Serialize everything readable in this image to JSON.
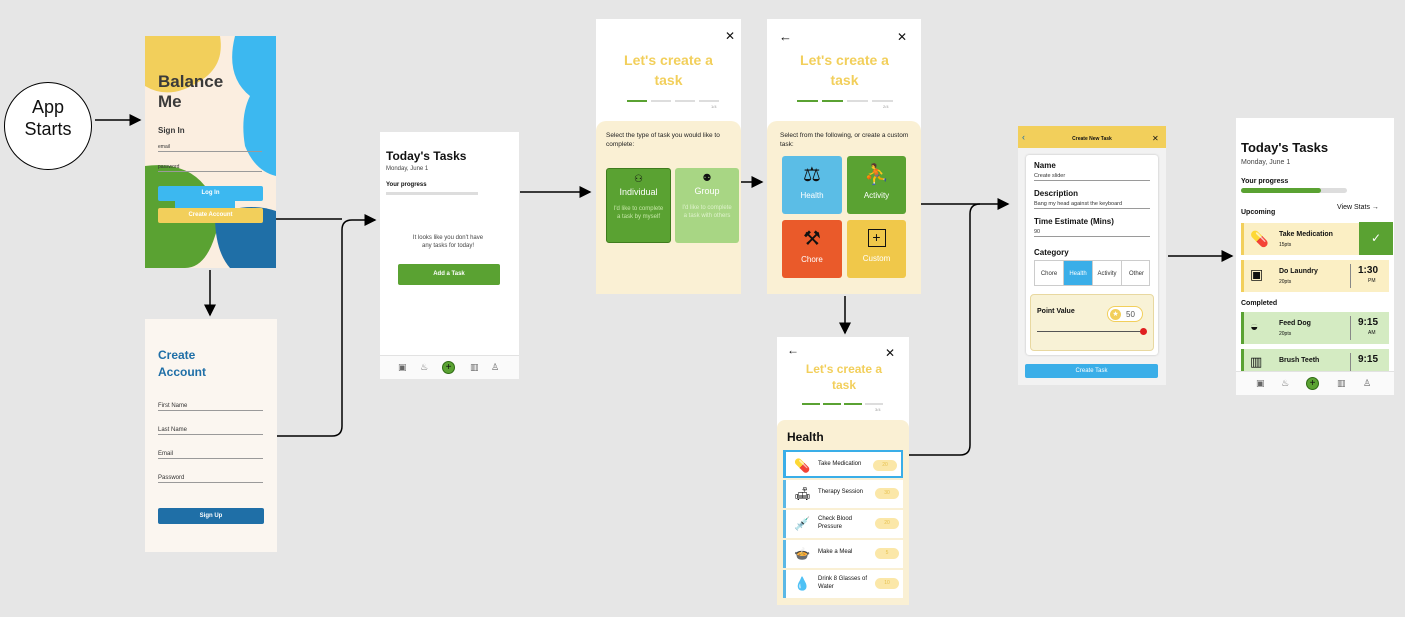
{
  "start": {
    "label": "App Starts"
  },
  "login": {
    "title": "Balance Me",
    "sign_in": "Sign In",
    "email_label": "email",
    "password_label": "password",
    "login_button": "Log In",
    "create_account_button": "Create Account"
  },
  "create_account": {
    "title": "Create Account",
    "fields": [
      "First Name",
      "Last Name",
      "Email",
      "Password"
    ],
    "signup_button": "Sign Up"
  },
  "tasks_empty": {
    "title": "Today's Tasks",
    "date": "Monday, June 1",
    "progress_label": "Your progress",
    "empty_message": "It looks like you don't have any tasks for today!",
    "add_button": "Add a Task"
  },
  "create_type": {
    "title": "Let's create a task",
    "close": "✕",
    "step": "1/4",
    "prompt": "Select the type of task you would like to complete:",
    "options": [
      {
        "label": "Individual",
        "desc": "I'd like to complete a task by myself",
        "icon": "individual-icon",
        "color": "#5aa232"
      },
      {
        "label": "Group",
        "desc": "I'd like to complete a task with others",
        "icon": "group-icon",
        "color": "#a8d684"
      }
    ]
  },
  "create_category": {
    "title": "Let's create a task",
    "back": "←",
    "close": "✕",
    "step": "2/4",
    "prompt": "Select from the following, or create a custom task:",
    "options": [
      {
        "label": "Health",
        "icon": "scale-icon",
        "color": "#5bbde6"
      },
      {
        "label": "Activity",
        "icon": "runner-icon",
        "color": "#5aa232"
      },
      {
        "label": "Chore",
        "icon": "broom-icon",
        "color": "#ea5a2a"
      },
      {
        "label": "Custom",
        "icon": "plus-box-icon",
        "color": "#f0c84a"
      }
    ]
  },
  "create_health": {
    "title": "Let's create a task",
    "back": "←",
    "close": "✕",
    "step": "3/4",
    "heading": "Health",
    "items": [
      {
        "label": "Take Medication",
        "points": "20",
        "icon": "pill-icon"
      },
      {
        "label": "Therapy Session",
        "points": "30",
        "icon": "couch-icon"
      },
      {
        "label": "Check Blood Pressure",
        "points": "20",
        "icon": "syringe-icon"
      },
      {
        "label": "Make a Meal",
        "points": "5",
        "icon": "meal-icon"
      },
      {
        "label": "Drink 8 Glasses of Water",
        "points": "10",
        "icon": "water-drop-icon"
      }
    ]
  },
  "new_task": {
    "header": "Create New Task",
    "name_label": "Name",
    "name_value": "Create slider",
    "desc_label": "Description",
    "desc_value": "Bang my head against the keyboard",
    "time_label": "Time Estimate (Mins)",
    "time_value": "90",
    "category_label": "Category",
    "categories": [
      "Chore",
      "Health",
      "Activity",
      "Other"
    ],
    "selected_category": "Health",
    "point_label": "Point Value",
    "point_value": "50",
    "submit": "Create Task"
  },
  "tasks_full": {
    "title": "Today's Tasks",
    "date": "Monday, June 1",
    "progress_label": "Your progress",
    "progress": 0.75,
    "upcoming_label": "Upcoming",
    "view_stats": "View Stats →",
    "upcoming": [
      {
        "name": "Take Medication",
        "pts": "15pts",
        "icon": "pill-icon",
        "action": "✓"
      },
      {
        "name": "Do Laundry",
        "pts": "20pts",
        "icon": "washer-icon",
        "time": "1:30",
        "ampm": "PM"
      }
    ],
    "completed_label": "Completed",
    "completed": [
      {
        "name": "Feed Dog",
        "pts": "20pts",
        "icon": "dog-bowl-icon",
        "time": "9:15",
        "ampm": "AM"
      },
      {
        "name": "Brush Teeth",
        "pts": "",
        "icon": "toothbrush-icon",
        "time": "9:15",
        "ampm": ""
      }
    ]
  },
  "nav": {
    "icons": [
      "calendar-icon",
      "activity-icon",
      "add-icon",
      "stats-icon",
      "profile-icon"
    ],
    "add": "+"
  },
  "colors": {
    "green": "#5aa232",
    "yellow": "#f2cf5b",
    "blue": "#3aaee8",
    "navy": "#1f6fa7",
    "red": "#ea5a2a"
  }
}
